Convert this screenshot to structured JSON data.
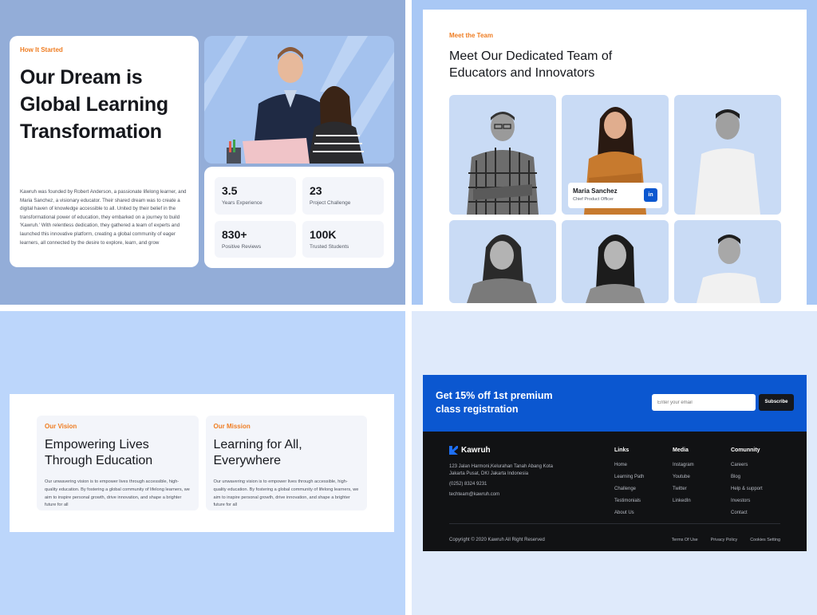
{
  "story": {
    "eyebrow": "How It Started",
    "title": "Our Dream is Global Learning Transformation",
    "body": "Kawruh was founded by Robert Anderson, a passionate lifelong learner, and Maria Sanchez, a visionary educator. Their shared dream was to create a digital haven of knowledge accessible to all. United by their belief in the transformational power of education, they embarked on a journey to build 'Kawruh.' With relentless dedication, they gathered a team of experts and launched this innovative platform, creating a global community of eager learners, all connected by the desire to explore, learn, and grow",
    "stats": [
      {
        "value": "3.5",
        "label": "Years Experience"
      },
      {
        "value": "23",
        "label": "Project Challenge"
      },
      {
        "value": "830+",
        "label": "Positive Reviews"
      },
      {
        "value": "100K",
        "label": "Trusted Students"
      }
    ]
  },
  "team": {
    "eyebrow": "Meet the Team",
    "title": "Meet Our Dedicated Team of Educators and Innovators",
    "featured": {
      "name": "Maria Sanchez",
      "role": "Chief Product Officer",
      "social": "in"
    }
  },
  "vision": {
    "eyebrow": "Our Vision",
    "title": "Empowering Lives Through Education",
    "body": "Our unwavering vision is to empower lives through accessible, high-quality education. By fostering a global community of lifelong learners, we aim to inspire personal growth, drive innovation, and shape a brighter future for all"
  },
  "mission": {
    "eyebrow": "Our Mission",
    "title": "Learning for All, Everywhere",
    "body": "Our unwavering vision is to empower lives through accessible, high-quality education. By fostering a global community of lifelong learners, we aim to inspire personal growth, drive innovation, and shape a brighter future for all"
  },
  "promo": {
    "title": "Get 15% off 1st premium class registration",
    "email_placeholder": "Enter your email",
    "button": "Subscribe"
  },
  "footer": {
    "brand": "Kawruh",
    "address": "123 Jalan Harmoni,Kelurahan Tanah Abang Kota Jakarta Pusat, DKI Jakarta Indonesia",
    "phone": "(0252) 8324 9231",
    "email": "techteam@kawruh.com",
    "columns": [
      {
        "heading": "Links",
        "items": [
          "Home",
          "Learning Path",
          "Challenge",
          "Testimonials",
          "About Us"
        ]
      },
      {
        "heading": "Media",
        "items": [
          "Instagram",
          "Youtube",
          "Twitter",
          "LinkedIn"
        ]
      },
      {
        "heading": "Comunnity",
        "items": [
          "Careers",
          "Blog",
          "Help & support",
          "Investors",
          "Contact"
        ]
      }
    ],
    "copyright": "Copyright © 2020 Kawruh All Right Reserved",
    "legal": [
      "Terms Of Use",
      "Privacy Policy",
      "Cookies Setting"
    ]
  },
  "colors": {
    "accent": "#0b57d0",
    "eyebrow": "#ef7d22",
    "footer_bg": "#111214"
  }
}
